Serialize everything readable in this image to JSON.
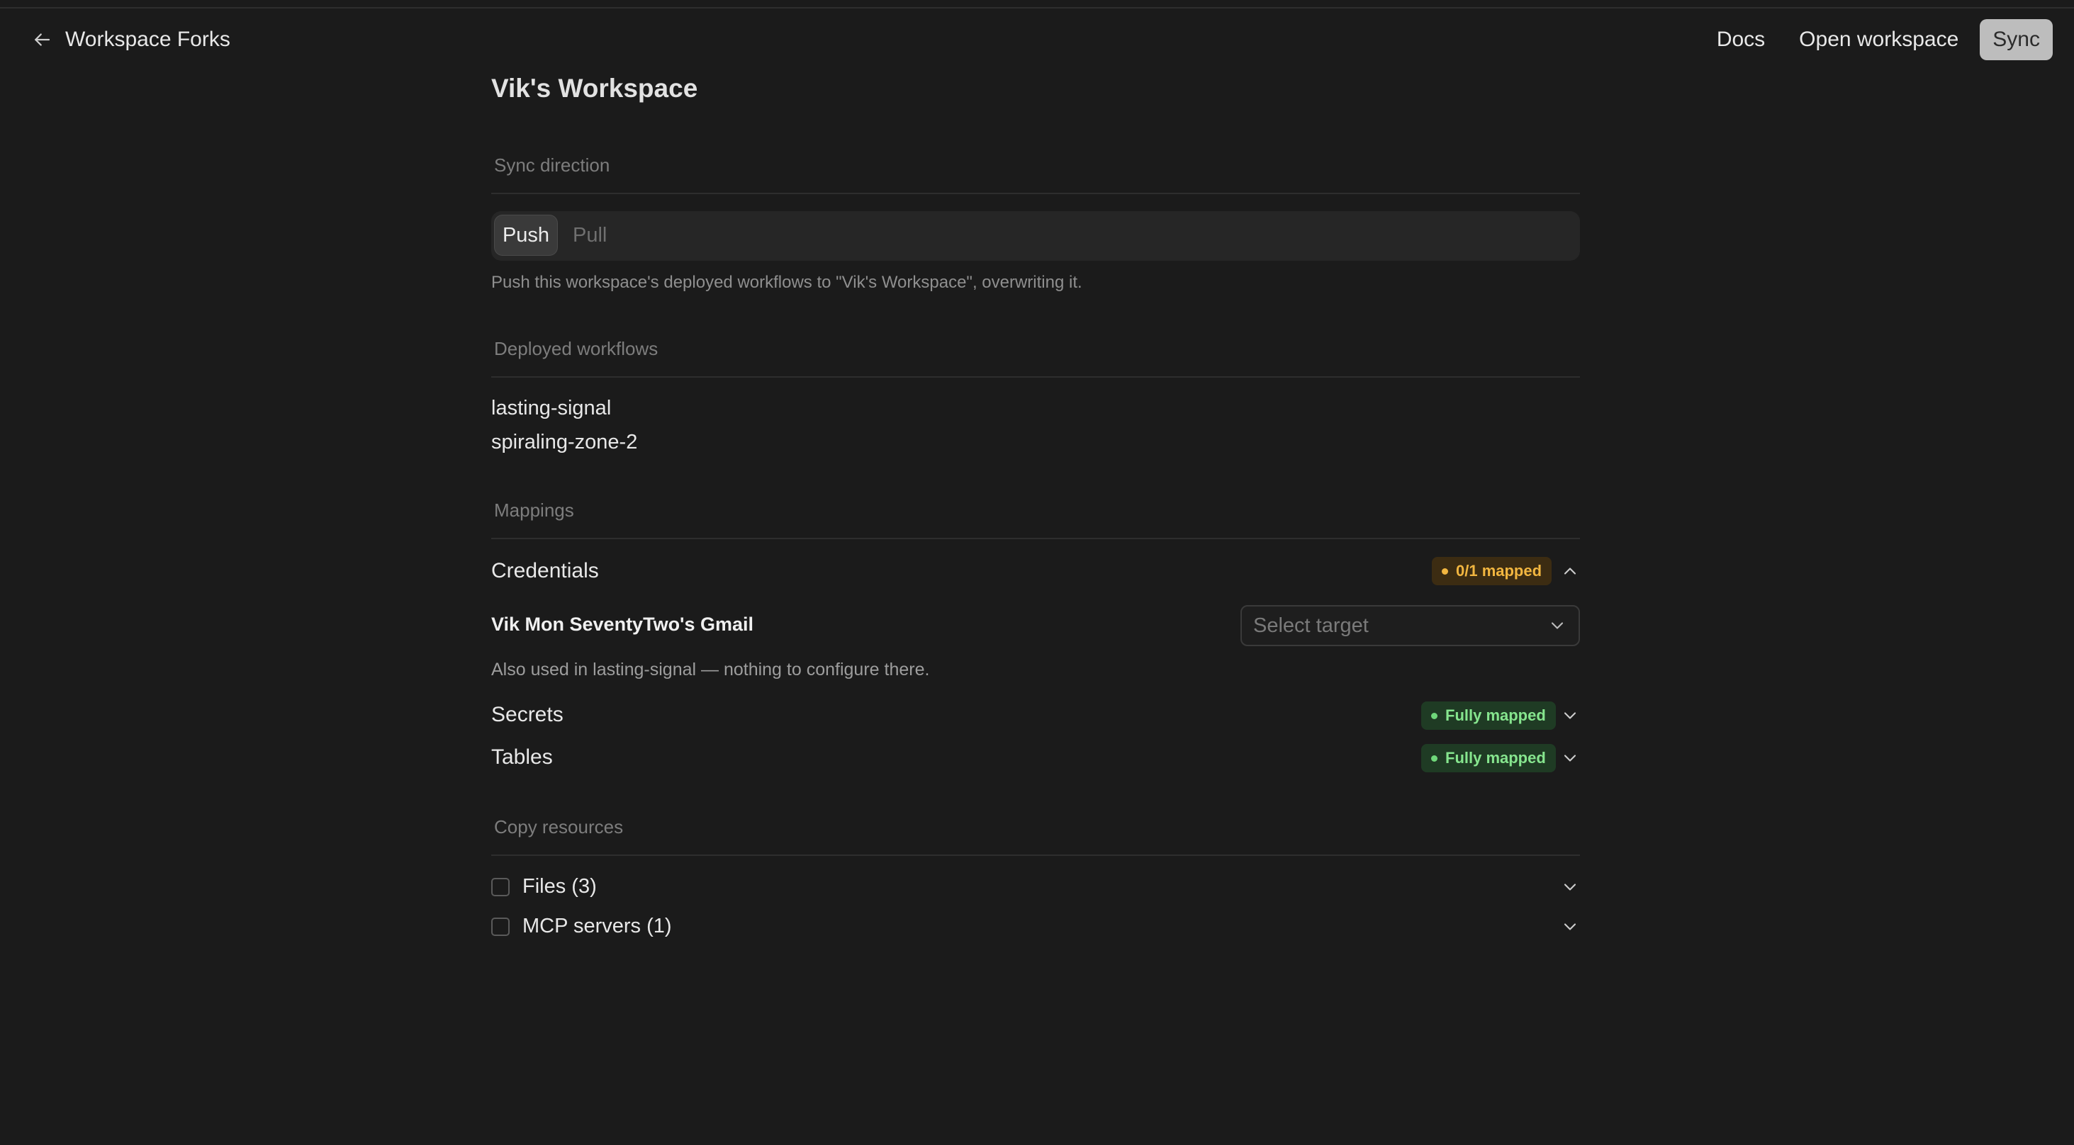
{
  "header": {
    "back_label": "Workspace Forks",
    "docs_label": "Docs",
    "open_workspace_label": "Open workspace",
    "sync_label": "Sync"
  },
  "page": {
    "title": "Vik's Workspace"
  },
  "sync_direction": {
    "section_label": "Sync direction",
    "options": [
      "Push",
      "Pull"
    ],
    "selected": "Push",
    "help_text": "Push this workspace's deployed workflows to \"Vik's Workspace\", overwriting it."
  },
  "deployed_workflows": {
    "section_label": "Deployed workflows",
    "items": [
      "lasting-signal",
      "spiraling-zone-2"
    ]
  },
  "mappings": {
    "section_label": "Mappings",
    "groups": [
      {
        "label": "Credentials",
        "status": "0/1 mapped",
        "state": "warning",
        "expanded": true
      },
      {
        "label": "Secrets",
        "status": "Fully mapped",
        "state": "ok",
        "expanded": false
      },
      {
        "label": "Tables",
        "status": "Fully mapped",
        "state": "ok",
        "expanded": false
      }
    ],
    "credential": {
      "name": "Vik Mon SeventyTwo's Gmail",
      "select_placeholder": "Select target",
      "note": "Also used in lasting-signal — nothing to configure there."
    }
  },
  "copy_resources": {
    "section_label": "Copy resources",
    "items": [
      {
        "label": "Files (3)",
        "checked": false
      },
      {
        "label": "MCP servers (1)",
        "checked": false
      }
    ]
  },
  "icons": {
    "back": "arrow-left-icon",
    "expand": "chevron-down-icon",
    "collapse": "chevron-up-icon"
  },
  "colors": {
    "background": "#1b1b1b",
    "warning_badge_bg": "#3c2c12",
    "warning_badge_text": "#f2b640",
    "ok_badge_bg": "#1f3b24",
    "ok_badge_text": "#86e58e",
    "sync_button_bg": "#bdbdbd"
  }
}
